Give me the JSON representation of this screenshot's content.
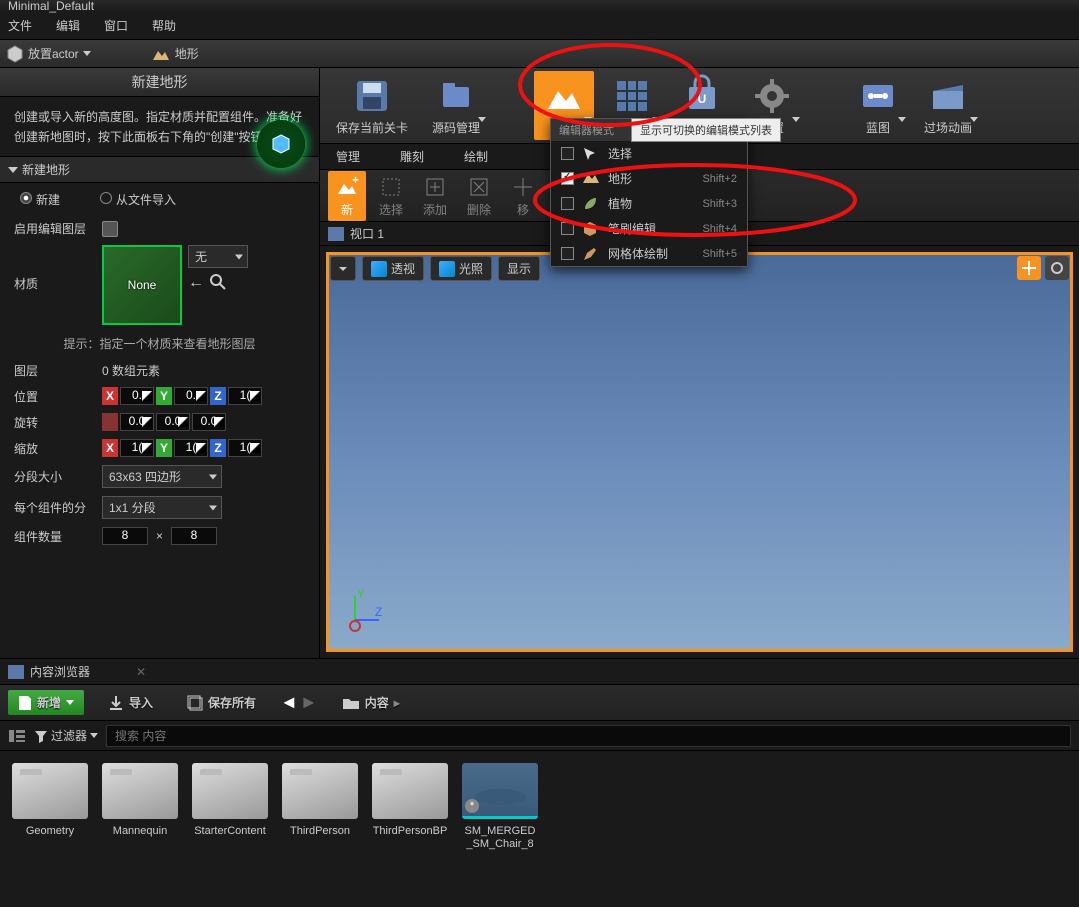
{
  "title": "Minimal_Default",
  "menu": {
    "file": "文件",
    "edit": "编辑",
    "window": "窗口",
    "help": "帮助"
  },
  "topstrip": {
    "place_actor": "放置actor",
    "landscape": "地形"
  },
  "left": {
    "header": "新建地形",
    "desc": "创建或导入新的高度图。指定材质并配置组件。准备好创建新地图时，按下此面板右下角的\"创建\"按钮即可。",
    "section": "新建地形",
    "radio_new": "新建",
    "radio_import": "从文件导入",
    "lbl_enable_layer": "启用编辑图层",
    "lbl_material": "材质",
    "mat_none": "None",
    "mat_dd": "无",
    "hint": "提示：指定一个材质来查看地形图层",
    "lbl_layers": "图层",
    "layers_count": "0 数组元素",
    "lbl_location": "位置",
    "loc": {
      "x": "0.",
      "y": "0.",
      "z": "1("
    },
    "lbl_rotation": "旋转",
    "rot": {
      "x": "0.0",
      "y": "0.0",
      "z": "0.0"
    },
    "lbl_scale": "缩放",
    "scl": {
      "x": "1(",
      "y": "1(",
      "z": "1("
    },
    "lbl_section_size": "分段大小",
    "section_size": "63x63 四边形",
    "lbl_sections_per": "每个组件的分",
    "sections_per": "1x1 分段",
    "lbl_comp_count": "组件数量",
    "comp": {
      "a": "8",
      "b": "8"
    }
  },
  "toolbar": {
    "save": "保存当前关卡",
    "source": "源码管理",
    "modes": "模式",
    "content": "内容",
    "market": "虚幻商城",
    "settings": "设置",
    "blueprint": "蓝图",
    "cinematic": "过场动画"
  },
  "tabs": {
    "manage": "管理",
    "sculpt": "雕刻",
    "paint": "绘制"
  },
  "subtool": {
    "new": "新",
    "select": "选择",
    "add": "添加",
    "delete": "删除",
    "move": "移"
  },
  "dropdown": {
    "header": "编辑器模式",
    "tooltip": "显示可切换的编辑模式列表",
    "items": [
      {
        "label": "选择",
        "shortcut": "",
        "checked": false
      },
      {
        "label": "地形",
        "shortcut": "Shift+2",
        "checked": true
      },
      {
        "label": "植物",
        "shortcut": "Shift+3",
        "checked": false
      },
      {
        "label": "笔刷编辑",
        "shortcut": "Shift+4",
        "checked": false
      },
      {
        "label": "网格体绘制",
        "shortcut": "Shift+5",
        "checked": false
      }
    ]
  },
  "viewport": {
    "tab": "视口 1",
    "perspective": "透视",
    "lit": "光照",
    "show": "显示"
  },
  "cb": {
    "tab": "内容浏览器",
    "add": "新增",
    "import": "导入",
    "saveall": "保存所有",
    "content": "内容",
    "filter": "过滤器",
    "search_ph": "搜索 内容",
    "assets": [
      "Geometry",
      "Mannequin",
      "StarterContent",
      "ThirdPerson",
      "ThirdPersonBP",
      "SM_MERGED_SM_Chair_8"
    ]
  }
}
